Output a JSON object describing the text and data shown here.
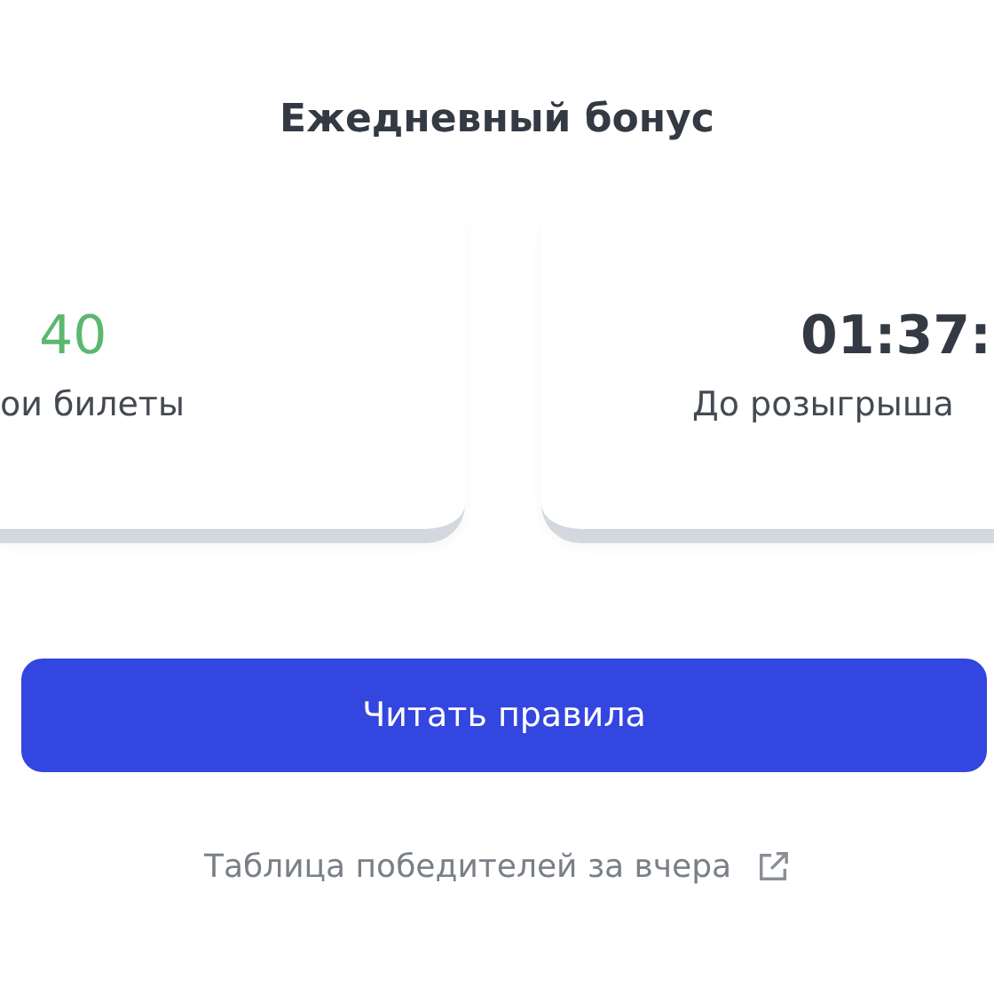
{
  "title": "Ежедневный бонус",
  "stats": [
    {
      "value": "40",
      "label": "ои билеты",
      "kind": "tickets"
    },
    {
      "value": "01:37:",
      "label": "До розыгрыша",
      "kind": "timer"
    }
  ],
  "button": "Читать правила",
  "link": "Таблица победителей за вчера"
}
